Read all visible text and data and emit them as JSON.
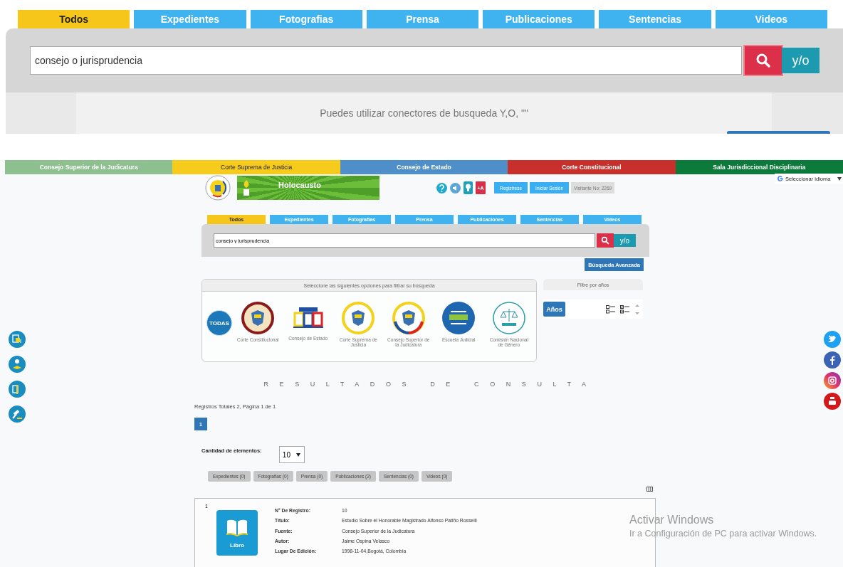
{
  "top_search": {
    "tabs": [
      {
        "label": "Todos",
        "selected": true
      },
      {
        "label": "Expedientes",
        "selected": false
      },
      {
        "label": "Fotografias",
        "selected": false
      },
      {
        "label": "Prensa",
        "selected": false
      },
      {
        "label": "Publicaciones",
        "selected": false
      },
      {
        "label": "Sentencias",
        "selected": false
      },
      {
        "label": "Videos",
        "selected": false
      }
    ],
    "query": "consejo o jurisprudencia",
    "connector": "y/o",
    "hint": "Puedes utilizar conectores de busqueda Y,O, \"\""
  },
  "court_bar": [
    {
      "label": "Consejo Superior de la Judicatura",
      "color": "#8dbf8f"
    },
    {
      "label": "Corte Suprema de Justicia",
      "color": "#f7cb1c"
    },
    {
      "label": "Consejo de Estado",
      "color": "#4f8fc9"
    },
    {
      "label": "Corte Constitucional",
      "color": "#c9302c"
    },
    {
      "label": "Sala Jurisdiccional Disciplinaria",
      "color": "#0b7a3b"
    }
  ],
  "header": {
    "banner": "Holocausto",
    "font_button": "+A",
    "buttons": [
      "Registrese",
      "Iniciar Sesión"
    ],
    "visitors": "Visitante No: 2269",
    "language": "Seleccionar idioma"
  },
  "tabs": [
    {
      "label": "Todos",
      "selected": true
    },
    {
      "label": "Expedientes",
      "selected": false
    },
    {
      "label": "Fotografias",
      "selected": false
    },
    {
      "label": "Prensa",
      "selected": false
    },
    {
      "label": "Publicaciones",
      "selected": false
    },
    {
      "label": "Sentencias",
      "selected": false
    },
    {
      "label": "Videos",
      "selected": false
    }
  ],
  "search": {
    "value": "consejo y jurisprudencia",
    "connector": "y/o",
    "advanced": "Búsqueda Avanzada"
  },
  "filter": {
    "title": "Seleccione las siguientes opciones para filtrar su búsqueda",
    "options": [
      {
        "kind": "todas",
        "label": "TODAS"
      },
      {
        "kind": "seal-red",
        "label": "Corte Constitucional"
      },
      {
        "kind": "building",
        "label": "Consejo de Estado"
      },
      {
        "kind": "seal-yellow",
        "label": "Corte Suprema de Justicia"
      },
      {
        "kind": "seal-tricolor",
        "label": "Consejo Superior de la Judicatura"
      },
      {
        "kind": "school",
        "label": "Escuela Judicial"
      },
      {
        "kind": "scale",
        "label": "Comisión Nacional de Género"
      }
    ]
  },
  "years_filter": {
    "title": "Filtre por años",
    "button": "Años"
  },
  "results": {
    "heading": "RESULTADOS DE CONSULTA",
    "summary": "Registros Totales 2, Página 1 de 1",
    "pages": [
      {
        "label": "1",
        "selected": true
      }
    ],
    "page_size_label": "Cantidad de elementos:",
    "page_size": "10",
    "categories": [
      "Expedientes (0)",
      "Fotografias (0)",
      "Prensa (0)",
      "Publicaciones (2)",
      "Sentencias (0)",
      "Videos (0)"
    ],
    "records": [
      {
        "index": "1",
        "type": "Libro",
        "fields": [
          {
            "label": "N° De Registro:",
            "value": "10"
          },
          {
            "label": "Título:",
            "value": "Estudio Sobre el Honorable Magistrado Alfonso Patiño Rosselli"
          },
          {
            "label": "Fuente:",
            "value": "Consejo Superior de la Judicatura"
          },
          {
            "label": "Autor:",
            "value": "Jaime Ospina Velasco"
          },
          {
            "label": "Lugar De Edición:",
            "value": "1998-11-04,Bogotá, Colombia"
          }
        ]
      }
    ]
  },
  "windows_notice": {
    "title": "Activar Windows",
    "text": "Ir a Configuración de PC para activar Windows."
  }
}
